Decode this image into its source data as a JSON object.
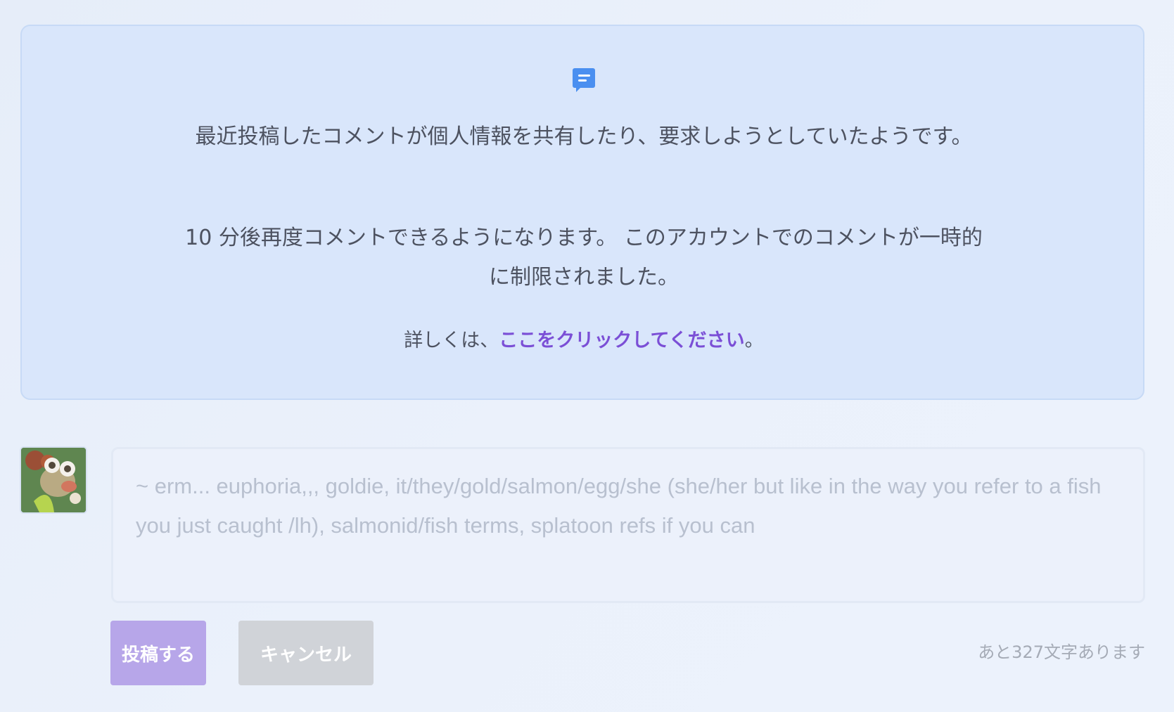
{
  "notice": {
    "icon": "comment-icon",
    "message_line": "最近投稿したコメントが個人情報を共有したり、要求しようとしていたようです。",
    "restriction_line": "10 分後再度コメントできるようになります。 このアカウントでのコメントが一時的に制限されました。",
    "details_prefix": "詳しくは、",
    "details_link": "ここをクリックしてください",
    "details_suffix": "。"
  },
  "comment": {
    "avatar": "user-avatar",
    "placeholder": "~ erm... euphoria,,, goldie, it/they/gold/salmon/egg/she (she/her but like in the way you refer to a fish you just caught /lh), salmonid/fish terms, splatoon refs if you can",
    "post_button": "投稿する",
    "cancel_button": "キャンセル",
    "remaining_chars": "あと327文字あります"
  },
  "colors": {
    "background": "#eaf0fb",
    "notice_bg": "#d9e6fb",
    "link": "#7b4fd6",
    "post_button": "#b7a6e9",
    "cancel_button": "#d0d3d8",
    "icon": "#4a8ff0"
  }
}
